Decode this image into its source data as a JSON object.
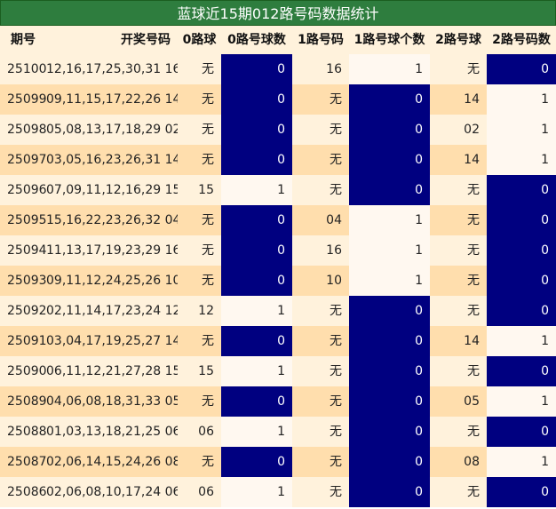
{
  "title": "蓝球近15期012路号码数据统计",
  "colors": {
    "odd_row": "#fff2dc",
    "even_row": "#ffdead",
    "wu_cell_odd": "#fff2dc",
    "wu_cell_even": "#ffdead",
    "value_bg": "#fff8f0",
    "zero_bg": "#000080",
    "zero_text": "#ffffff"
  },
  "chart_data": {
    "type": "table",
    "columns": [
      "期号",
      "开奖号码",
      "0路球",
      "0路号球数",
      "1路号码",
      "1路号球个数",
      "2路号球",
      "2路号码数"
    ],
    "rows": [
      [
        "25100",
        "12,16,17,25,30,31 16",
        "无",
        "0",
        "16",
        "1",
        "无",
        "0"
      ],
      [
        "25099",
        "09,11,15,17,22,26 14",
        "无",
        "0",
        "无",
        "0",
        "14",
        "1"
      ],
      [
        "25098",
        "05,08,13,17,18,29 02",
        "无",
        "0",
        "无",
        "0",
        "02",
        "1"
      ],
      [
        "25097",
        "03,05,16,23,26,31 14",
        "无",
        "0",
        "无",
        "0",
        "14",
        "1"
      ],
      [
        "25096",
        "07,09,11,12,16,29 15",
        "15",
        "1",
        "无",
        "0",
        "无",
        "0"
      ],
      [
        "25095",
        "15,16,22,23,26,32 04",
        "无",
        "0",
        "04",
        "1",
        "无",
        "0"
      ],
      [
        "25094",
        "11,13,17,19,23,29 16",
        "无",
        "0",
        "16",
        "1",
        "无",
        "0"
      ],
      [
        "25093",
        "09,11,12,24,25,26 10",
        "无",
        "0",
        "10",
        "1",
        "无",
        "0"
      ],
      [
        "25092",
        "02,11,14,17,23,24 12",
        "12",
        "1",
        "无",
        "0",
        "无",
        "0"
      ],
      [
        "25091",
        "03,04,17,19,25,27 14",
        "无",
        "0",
        "无",
        "0",
        "14",
        "1"
      ],
      [
        "25090",
        "06,11,12,21,27,28 15",
        "15",
        "1",
        "无",
        "0",
        "无",
        "0"
      ],
      [
        "25089",
        "04,06,08,18,31,33 05",
        "无",
        "0",
        "无",
        "0",
        "05",
        "1"
      ],
      [
        "25088",
        "01,03,13,18,21,25 06",
        "06",
        "1",
        "无",
        "0",
        "无",
        "0"
      ],
      [
        "25087",
        "02,06,14,15,24,26 08",
        "无",
        "0",
        "无",
        "0",
        "08",
        "1"
      ],
      [
        "25086",
        "02,06,08,10,17,24 06",
        "06",
        "1",
        "无",
        "0",
        "无",
        "0"
      ]
    ]
  }
}
